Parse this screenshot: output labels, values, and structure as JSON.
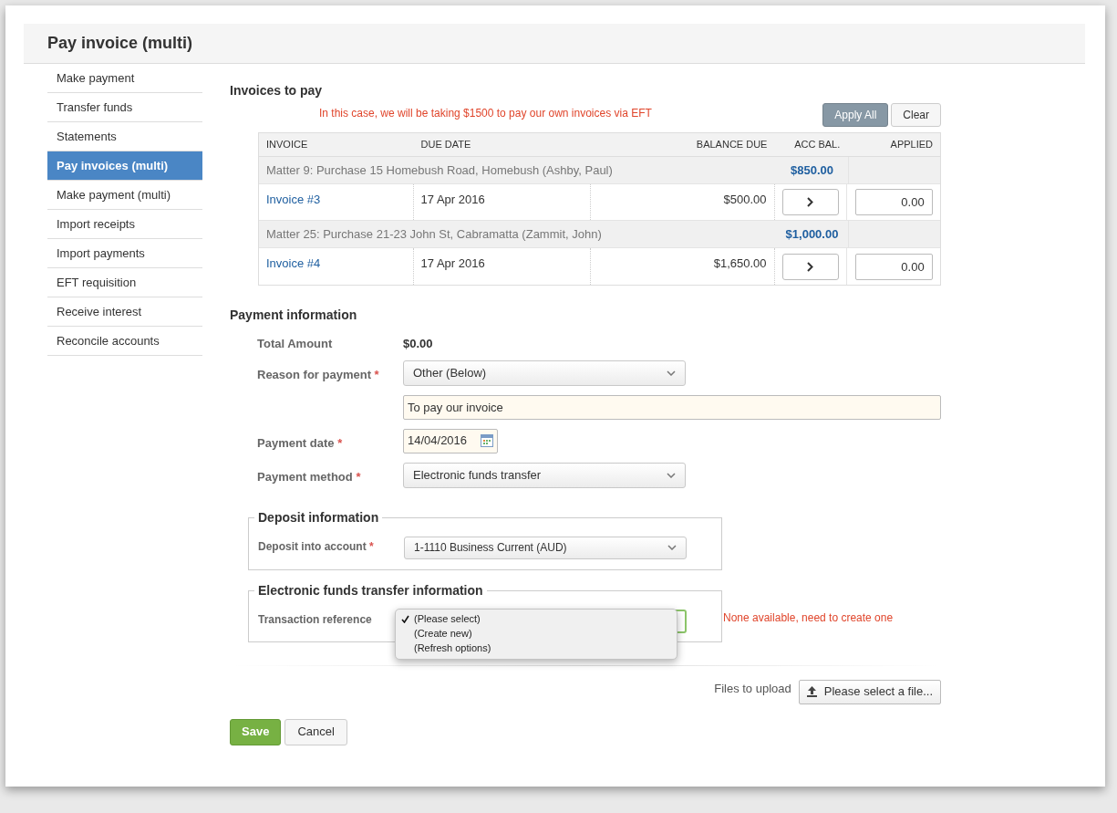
{
  "page": {
    "title": "Pay invoice (multi)"
  },
  "sidebar": {
    "items": [
      {
        "label": "Make payment",
        "selected": false
      },
      {
        "label": "Transfer funds",
        "selected": false
      },
      {
        "label": "Statements",
        "selected": false
      },
      {
        "label": "Pay invoices (multi)",
        "selected": true
      },
      {
        "label": "Make payment (multi)",
        "selected": false
      },
      {
        "label": "Import receipts",
        "selected": false
      },
      {
        "label": "Import payments",
        "selected": false
      },
      {
        "label": "EFT requisition",
        "selected": false
      },
      {
        "label": "Receive interest",
        "selected": false
      },
      {
        "label": "Reconcile accounts",
        "selected": false
      }
    ]
  },
  "invoices": {
    "heading": "Invoices to pay",
    "note": "In this case, we will be taking $1500 to pay our own invoices via EFT",
    "buttons": [
      {
        "label": "Apply All",
        "kind": "primary"
      },
      {
        "label": "Clear",
        "kind": "default"
      }
    ],
    "columns": [
      "INVOICE",
      "DUE DATE",
      "BALANCE DUE",
      "ACC BAL.",
      "APPLIED"
    ],
    "rows": [
      {
        "kind": "matter",
        "title": "Matter 9: Purchase 15 Homebush Road, Homebush (Ashby, Paul)",
        "acc_bal": "$850.00"
      },
      {
        "kind": "invoice",
        "invoice": "Invoice #3",
        "due_date": "17 Apr 2016",
        "balance_due": "$500.00",
        "applied": "0.00"
      },
      {
        "kind": "matter",
        "title": "Matter 25: Purchase 21-23 John St, Cabramatta (Zammit, John)",
        "acc_bal": "$1,000.00"
      },
      {
        "kind": "invoice",
        "invoice": "Invoice #4",
        "due_date": "17 Apr 2016",
        "balance_due": "$1,650.00",
        "applied": "0.00"
      }
    ]
  },
  "payment": {
    "heading": "Payment information",
    "fields": [
      {
        "kind": "static",
        "label": "Total Amount",
        "value": "$0.00"
      },
      {
        "kind": "select",
        "label": "Reason for payment",
        "required_mark": "*",
        "value": "Other (Below)"
      },
      {
        "kind": "text",
        "value": "To pay our invoice"
      },
      {
        "kind": "date",
        "label": "Payment date",
        "required_mark": "*",
        "value": "14/04/2016"
      },
      {
        "kind": "select",
        "label": "Payment method",
        "required_mark": "*",
        "value": "Electronic funds transfer"
      }
    ]
  },
  "deposit": {
    "legend": "Deposit information",
    "label": "Deposit into account",
    "required_mark": "*",
    "value": "1-1110 Business Current (AUD)"
  },
  "eft": {
    "legend": "Electronic funds transfer information",
    "label": "Transaction reference",
    "error": "None available, need to create one",
    "options": [
      {
        "label": "(Please select)",
        "selected": true
      },
      {
        "label": "(Create new)",
        "selected": false
      },
      {
        "label": "(Refresh options)",
        "selected": false
      }
    ]
  },
  "upload": {
    "label": "Files to upload",
    "button": "Please select a file..."
  },
  "actions": [
    {
      "label": "Save",
      "kind": "primary"
    },
    {
      "label": "Cancel",
      "kind": "default"
    }
  ]
}
